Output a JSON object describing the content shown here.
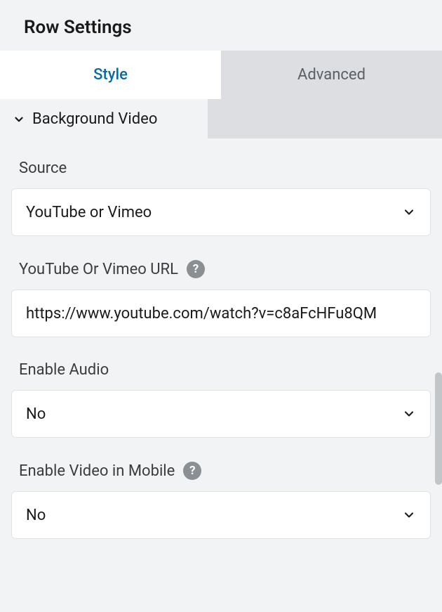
{
  "panel": {
    "title": "Row Settings"
  },
  "tabs": {
    "style": "Style",
    "advanced": "Advanced"
  },
  "section": {
    "title": "Background Video"
  },
  "fields": {
    "source": {
      "label": "Source",
      "value": "YouTube or Vimeo"
    },
    "url": {
      "label": "YouTube Or Vimeo URL",
      "value": "https://www.youtube.com/watch?v=c8aFcHFu8QM"
    },
    "audio": {
      "label": "Enable Audio",
      "value": "No"
    },
    "mobile": {
      "label": "Enable Video in Mobile",
      "value": "No"
    }
  },
  "help_tooltip": "?"
}
